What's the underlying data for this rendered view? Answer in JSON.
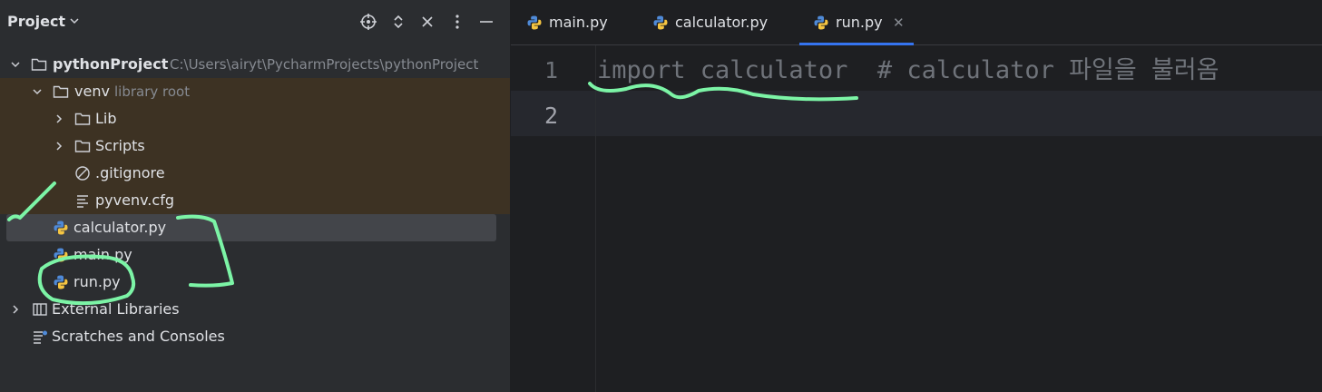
{
  "project_panel": {
    "title": "Project",
    "header_icons": [
      "locate-icon",
      "expand-collapse-icon",
      "close-icon",
      "more-options-icon",
      "minimize-icon"
    ],
    "tree": {
      "root": {
        "label": "pythonProject",
        "path": "C:\\Users\\airyt\\PycharmProjects\\pythonProject"
      },
      "venv": {
        "label": "venv",
        "hint": "library root"
      },
      "lib": {
        "label": "Lib"
      },
      "scripts": {
        "label": "Scripts"
      },
      "gitignore": {
        "label": ".gitignore"
      },
      "pyvenv": {
        "label": "pyvenv.cfg"
      },
      "calculator": {
        "label": "calculator.py"
      },
      "main": {
        "label": "main.py"
      },
      "run": {
        "label": "run.py"
      },
      "external": {
        "label": "External Libraries"
      },
      "scratches": {
        "label": "Scratches and Consoles"
      }
    }
  },
  "editor": {
    "tabs": [
      {
        "label": "main.py"
      },
      {
        "label": "calculator.py"
      },
      {
        "label": "run.py",
        "active": true
      }
    ],
    "lines": [
      {
        "number": "1",
        "text": "import calculator  # calculator 파일을 불러옴"
      },
      {
        "number": "2",
        "text": ""
      }
    ]
  },
  "colors": {
    "accent": "#3574f0",
    "annotation": "#7cf4a6",
    "excluded_bg": "#3d3223"
  }
}
